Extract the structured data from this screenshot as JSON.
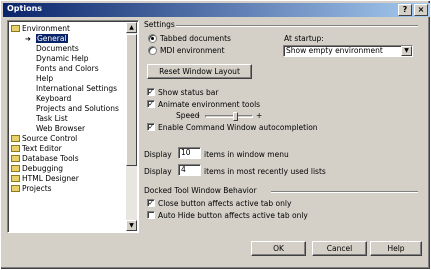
{
  "window": {
    "title": "Options",
    "help_btn": "?",
    "close_btn": "×"
  },
  "tree": [
    {
      "label": "Environment",
      "expanded": true
    },
    {
      "label": "General",
      "selected": true
    },
    {
      "label": "Documents"
    },
    {
      "label": "Dynamic Help"
    },
    {
      "label": "Fonts and Colors"
    },
    {
      "label": "Help"
    },
    {
      "label": "International Settings"
    },
    {
      "label": "Keyboard"
    },
    {
      "label": "Projects and Solutions"
    },
    {
      "label": "Task List"
    },
    {
      "label": "Web Browser"
    },
    {
      "label": "Source Control"
    },
    {
      "label": "Text Editor"
    },
    {
      "label": "Database Tools"
    },
    {
      "label": "Debugging"
    },
    {
      "label": "HTML Designer"
    },
    {
      "label": "Projects"
    }
  ],
  "tree_scroll": {
    "up": "▲",
    "down": "▼"
  },
  "settings": {
    "heading": "Settings",
    "tabbed_documents": {
      "label": "Tabbed documents",
      "checked": true
    },
    "mdi_environment": {
      "label": "MDI environment",
      "checked": false
    },
    "at_startup_label": "At startup:",
    "at_startup_value": "Show empty environment",
    "dropdown_arrow": "▼",
    "reset_layout": "Reset Window Layout",
    "show_status_bar": {
      "label": "Show status bar",
      "checked": true
    },
    "animate_tools": {
      "label": "Animate environment tools",
      "checked": true
    },
    "speed_label": "Speed",
    "speed_minus": "-",
    "speed_plus": "+",
    "enable_command": {
      "label": "Enable Command Window autocompletion",
      "checked": true
    },
    "display_label_1": "Display",
    "window_menu_count": "10",
    "window_menu_suffix": "items in window menu",
    "display_label_2": "Display",
    "mru_count": "4",
    "mru_suffix": "items in most recently used lists"
  },
  "docked": {
    "heading": "Docked Tool Window Behavior",
    "close_affects": {
      "label": "Close button affects active tab only",
      "checked": true
    },
    "autohide_affects": {
      "label": "Auto Hide button affects active tab only",
      "checked": false
    }
  },
  "buttons": {
    "ok": "OK",
    "cancel": "Cancel",
    "help": "Help"
  },
  "check_glyph": "✓"
}
